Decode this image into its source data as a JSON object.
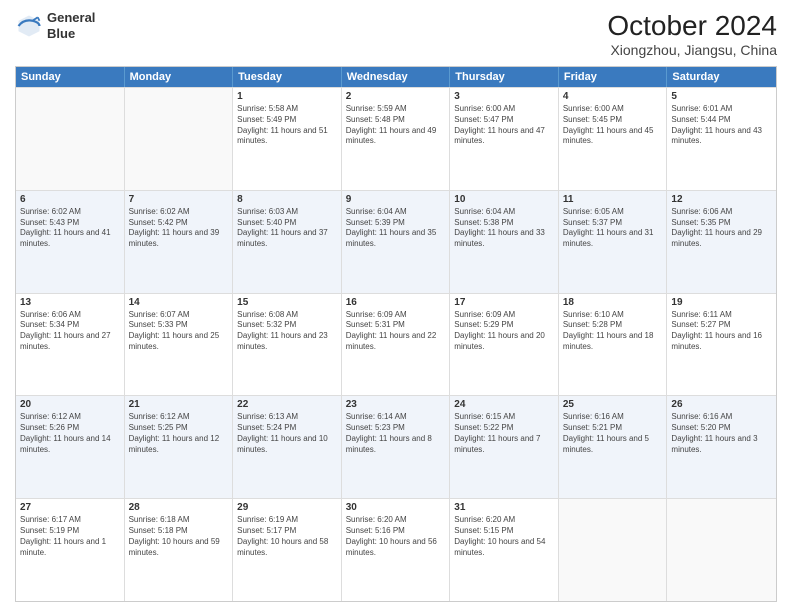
{
  "header": {
    "logo_line1": "General",
    "logo_line2": "Blue",
    "title": "October 2024",
    "subtitle": "Xiongzhou, Jiangsu, China"
  },
  "days_of_week": [
    "Sunday",
    "Monday",
    "Tuesday",
    "Wednesday",
    "Thursday",
    "Friday",
    "Saturday"
  ],
  "weeks": [
    [
      {
        "day": "",
        "info": ""
      },
      {
        "day": "",
        "info": ""
      },
      {
        "day": "1",
        "info": "Sunrise: 5:58 AM\nSunset: 5:49 PM\nDaylight: 11 hours and 51 minutes."
      },
      {
        "day": "2",
        "info": "Sunrise: 5:59 AM\nSunset: 5:48 PM\nDaylight: 11 hours and 49 minutes."
      },
      {
        "day": "3",
        "info": "Sunrise: 6:00 AM\nSunset: 5:47 PM\nDaylight: 11 hours and 47 minutes."
      },
      {
        "day": "4",
        "info": "Sunrise: 6:00 AM\nSunset: 5:45 PM\nDaylight: 11 hours and 45 minutes."
      },
      {
        "day": "5",
        "info": "Sunrise: 6:01 AM\nSunset: 5:44 PM\nDaylight: 11 hours and 43 minutes."
      }
    ],
    [
      {
        "day": "6",
        "info": "Sunrise: 6:02 AM\nSunset: 5:43 PM\nDaylight: 11 hours and 41 minutes."
      },
      {
        "day": "7",
        "info": "Sunrise: 6:02 AM\nSunset: 5:42 PM\nDaylight: 11 hours and 39 minutes."
      },
      {
        "day": "8",
        "info": "Sunrise: 6:03 AM\nSunset: 5:40 PM\nDaylight: 11 hours and 37 minutes."
      },
      {
        "day": "9",
        "info": "Sunrise: 6:04 AM\nSunset: 5:39 PM\nDaylight: 11 hours and 35 minutes."
      },
      {
        "day": "10",
        "info": "Sunrise: 6:04 AM\nSunset: 5:38 PM\nDaylight: 11 hours and 33 minutes."
      },
      {
        "day": "11",
        "info": "Sunrise: 6:05 AM\nSunset: 5:37 PM\nDaylight: 11 hours and 31 minutes."
      },
      {
        "day": "12",
        "info": "Sunrise: 6:06 AM\nSunset: 5:35 PM\nDaylight: 11 hours and 29 minutes."
      }
    ],
    [
      {
        "day": "13",
        "info": "Sunrise: 6:06 AM\nSunset: 5:34 PM\nDaylight: 11 hours and 27 minutes."
      },
      {
        "day": "14",
        "info": "Sunrise: 6:07 AM\nSunset: 5:33 PM\nDaylight: 11 hours and 25 minutes."
      },
      {
        "day": "15",
        "info": "Sunrise: 6:08 AM\nSunset: 5:32 PM\nDaylight: 11 hours and 23 minutes."
      },
      {
        "day": "16",
        "info": "Sunrise: 6:09 AM\nSunset: 5:31 PM\nDaylight: 11 hours and 22 minutes."
      },
      {
        "day": "17",
        "info": "Sunrise: 6:09 AM\nSunset: 5:29 PM\nDaylight: 11 hours and 20 minutes."
      },
      {
        "day": "18",
        "info": "Sunrise: 6:10 AM\nSunset: 5:28 PM\nDaylight: 11 hours and 18 minutes."
      },
      {
        "day": "19",
        "info": "Sunrise: 6:11 AM\nSunset: 5:27 PM\nDaylight: 11 hours and 16 minutes."
      }
    ],
    [
      {
        "day": "20",
        "info": "Sunrise: 6:12 AM\nSunset: 5:26 PM\nDaylight: 11 hours and 14 minutes."
      },
      {
        "day": "21",
        "info": "Sunrise: 6:12 AM\nSunset: 5:25 PM\nDaylight: 11 hours and 12 minutes."
      },
      {
        "day": "22",
        "info": "Sunrise: 6:13 AM\nSunset: 5:24 PM\nDaylight: 11 hours and 10 minutes."
      },
      {
        "day": "23",
        "info": "Sunrise: 6:14 AM\nSunset: 5:23 PM\nDaylight: 11 hours and 8 minutes."
      },
      {
        "day": "24",
        "info": "Sunrise: 6:15 AM\nSunset: 5:22 PM\nDaylight: 11 hours and 7 minutes."
      },
      {
        "day": "25",
        "info": "Sunrise: 6:16 AM\nSunset: 5:21 PM\nDaylight: 11 hours and 5 minutes."
      },
      {
        "day": "26",
        "info": "Sunrise: 6:16 AM\nSunset: 5:20 PM\nDaylight: 11 hours and 3 minutes."
      }
    ],
    [
      {
        "day": "27",
        "info": "Sunrise: 6:17 AM\nSunset: 5:19 PM\nDaylight: 11 hours and 1 minute."
      },
      {
        "day": "28",
        "info": "Sunrise: 6:18 AM\nSunset: 5:18 PM\nDaylight: 10 hours and 59 minutes."
      },
      {
        "day": "29",
        "info": "Sunrise: 6:19 AM\nSunset: 5:17 PM\nDaylight: 10 hours and 58 minutes."
      },
      {
        "day": "30",
        "info": "Sunrise: 6:20 AM\nSunset: 5:16 PM\nDaylight: 10 hours and 56 minutes."
      },
      {
        "day": "31",
        "info": "Sunrise: 6:20 AM\nSunset: 5:15 PM\nDaylight: 10 hours and 54 minutes."
      },
      {
        "day": "",
        "info": ""
      },
      {
        "day": "",
        "info": ""
      }
    ]
  ]
}
